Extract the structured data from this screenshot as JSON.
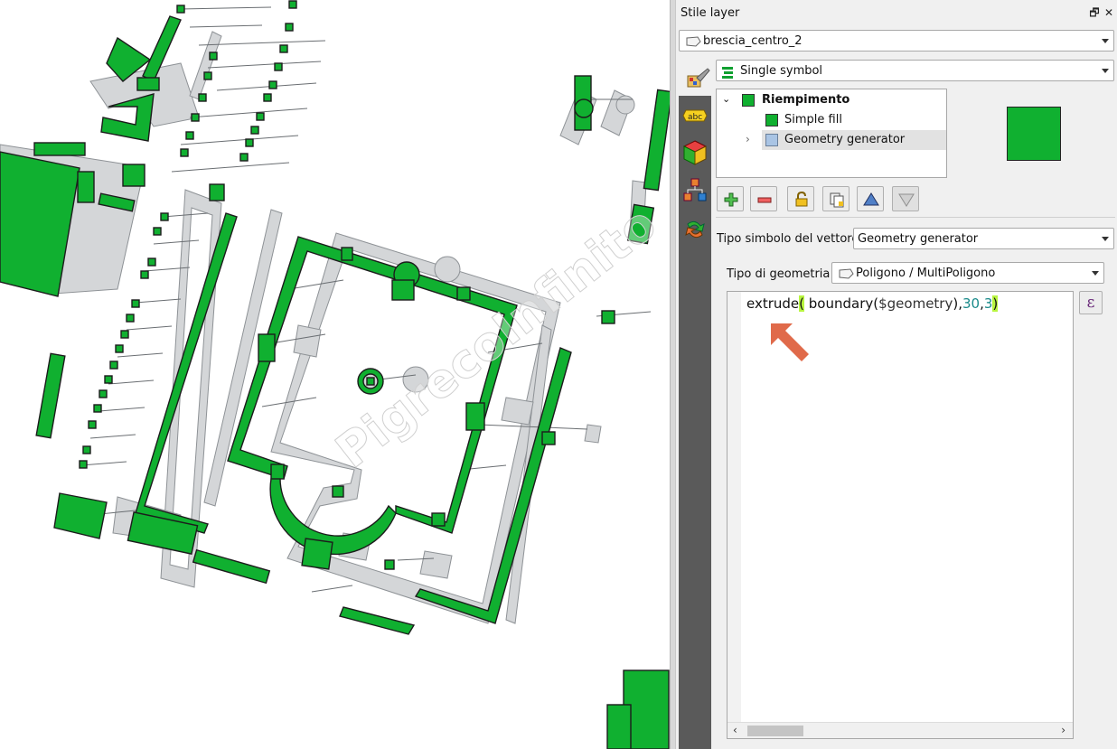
{
  "panel": {
    "title": "Stile layer",
    "float_icon": "float-icon",
    "close_icon": "close-icon",
    "float_glyph": "🗗",
    "close_glyph": "✕"
  },
  "layer_select": {
    "value": "brescia_centro_2",
    "icon": "polygon-layer-icon"
  },
  "renderer_select": {
    "value": "Single symbol",
    "icon": "single-symbol-icon"
  },
  "sidebar": {
    "items": [
      {
        "name": "symbology-tab-icon"
      },
      {
        "name": "labels-tab-icon",
        "text": "abc"
      },
      {
        "name": "3d-view-tab-icon"
      },
      {
        "name": "diagrams-tab-icon"
      },
      {
        "name": "history-tab-icon"
      }
    ]
  },
  "symbol_tree": {
    "items": [
      {
        "label": "Riempimento",
        "color": "#10b030",
        "level": 0,
        "expanded": true,
        "bold": true
      },
      {
        "label": "Simple fill",
        "color": "#10b030",
        "level": 1
      },
      {
        "label": "Geometry generator",
        "color": "#a9c4e4",
        "level": 1,
        "selected": true,
        "collapsed": true
      }
    ]
  },
  "preview_color": "#10b030",
  "toolbar": {
    "buttons": [
      {
        "name": "add-layer-icon"
      },
      {
        "name": "remove-layer-icon"
      },
      {
        "name": "lock-layer-icon"
      },
      {
        "name": "duplicate-layer-icon"
      },
      {
        "name": "move-up-icon"
      },
      {
        "name": "move-down-icon"
      }
    ]
  },
  "symbol_layer_type": {
    "label": "Tipo simbolo del vettore",
    "value": "Geometry generator"
  },
  "geometry_type": {
    "label": "Tipo di geometria",
    "value": "Poligono / MultiPoligono",
    "icon": "polygon-icon"
  },
  "expression": {
    "func": "extrude",
    "open_paren": "(",
    "inner": " boundary(",
    "var": "$geometry",
    "close_inner": "),",
    "num1": "30",
    "comma": ",",
    "num2": "3",
    "close_paren": ")"
  },
  "expression_button": {
    "glyph": "ε",
    "icon": "expression-icon"
  },
  "colors": {
    "accent_green": "#10b030",
    "ghost_gray": "#d4d6d8",
    "arrow_orange": "#e06a4a",
    "sidebar_bg": "#5a5a5a"
  }
}
